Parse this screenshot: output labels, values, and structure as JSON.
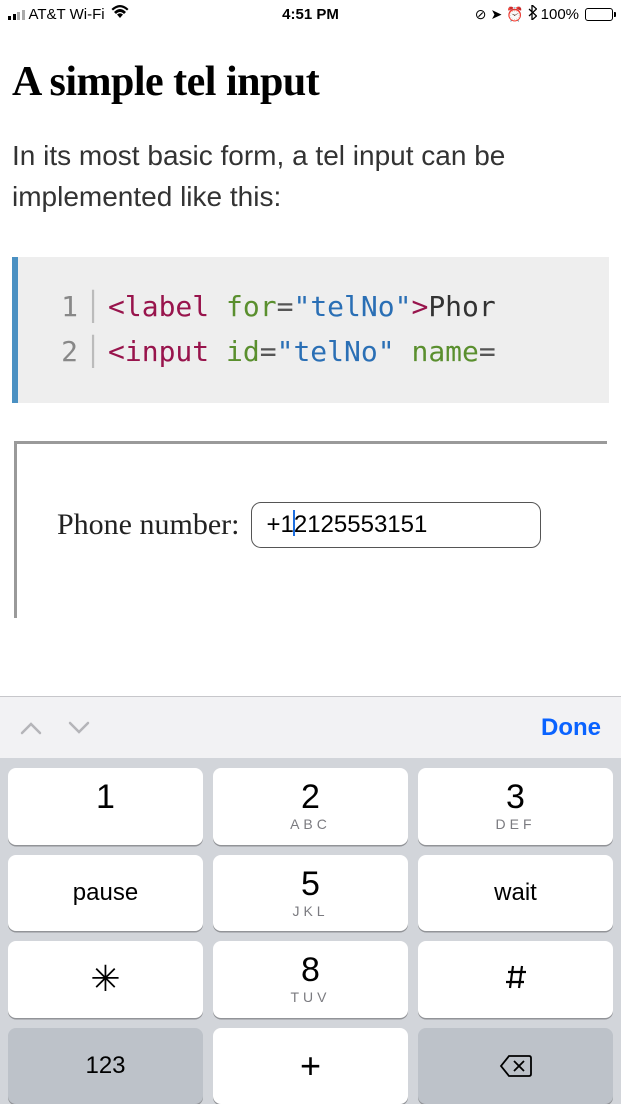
{
  "status": {
    "carrier": "AT&T Wi-Fi",
    "time": "4:51 PM",
    "battery_pct": "100%"
  },
  "page": {
    "title": "A simple tel input",
    "body": "In its most basic form, a tel input can be implemented like this:"
  },
  "code": {
    "line1": {
      "num": "1",
      "tag": "label",
      "attr1": "for",
      "val1": "telNo",
      "after": "Phor"
    },
    "line2": {
      "num": "2",
      "tag": "input",
      "attr1": "id",
      "val1": "telNo",
      "attr2": "name"
    }
  },
  "example": {
    "label": "Phone number:",
    "value_pre": "+1",
    "value_post": "2125553151"
  },
  "kb": {
    "done": "Done",
    "keys": {
      "k1": {
        "main": "1",
        "sub": ""
      },
      "k2": {
        "main": "2",
        "sub": "ABC"
      },
      "k3": {
        "main": "3",
        "sub": "DEF"
      },
      "pause": {
        "main": "pause"
      },
      "k5": {
        "main": "5",
        "sub": "JKL"
      },
      "wait": {
        "main": "wait"
      },
      "star": {
        "main": "✳"
      },
      "k8": {
        "main": "8",
        "sub": "TUV"
      },
      "hash": {
        "main": "#"
      },
      "mode": {
        "main": "123"
      },
      "plus": {
        "main": "+"
      }
    }
  }
}
